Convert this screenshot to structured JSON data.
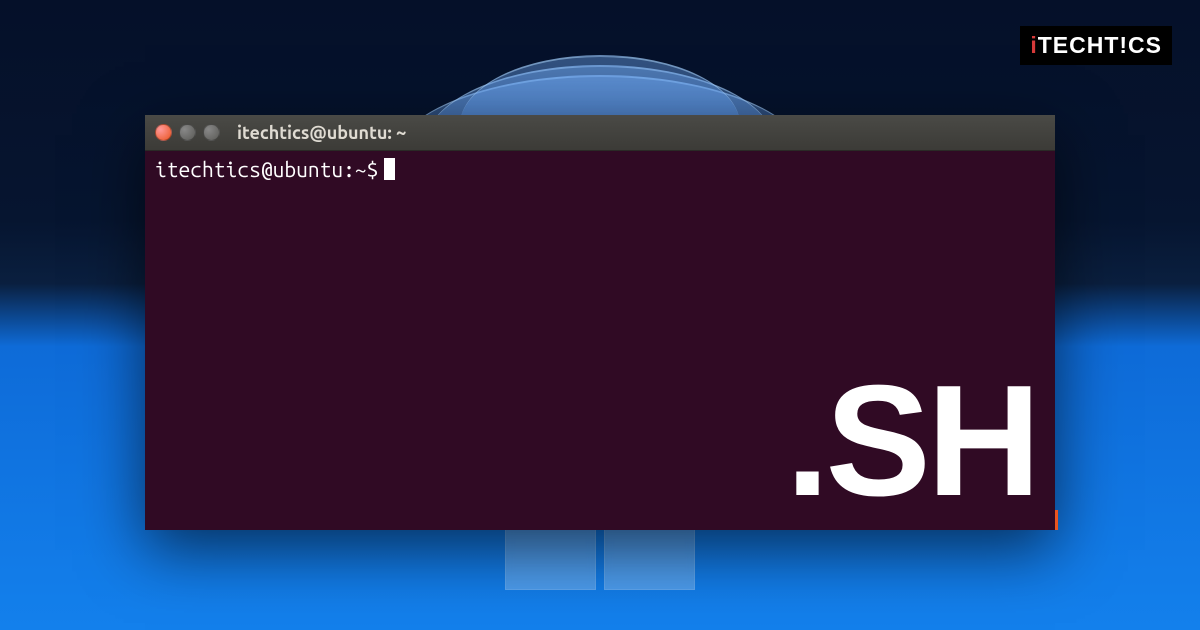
{
  "brand": {
    "prefix": "i",
    "name": "TECHT!CS"
  },
  "terminal": {
    "titlebar": "itechtics@ubuntu: ~",
    "prompt": "itechtics@ubuntu:~$",
    "overlay": ".SH"
  },
  "window_controls": {
    "close": "close",
    "minimize": "minimize",
    "maximize": "maximize"
  }
}
